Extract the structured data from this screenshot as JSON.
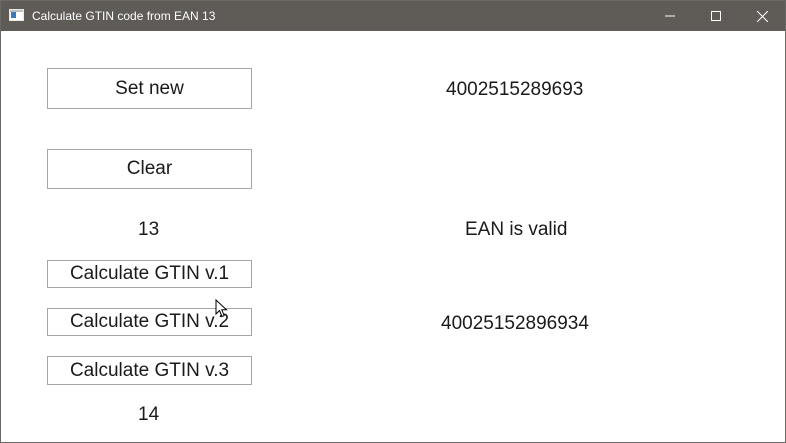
{
  "window": {
    "title": "Calculate GTIN code from EAN 13",
    "controls": {
      "minimize_icon": "minimize-icon",
      "maximize_icon": "maximize-icon",
      "close_icon": "close-icon"
    },
    "titlebar_color": "#5f5b57"
  },
  "buttons": {
    "set_new": "Set new",
    "clear": "Clear",
    "gtin_v1": "Calculate GTIN v.1",
    "gtin_v2": "Calculate GTIN v.2",
    "gtin_v3": "Calculate GTIN v.3"
  },
  "values": {
    "ean": "4002515289693",
    "ean_length": "13",
    "ean_status": "EAN is valid",
    "gtin": "40025152896934",
    "gtin_length": "14"
  }
}
